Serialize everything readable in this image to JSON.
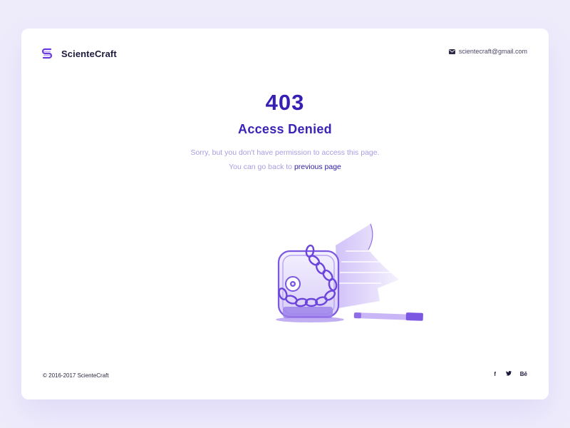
{
  "brand": {
    "name": "ScienteCraft",
    "logo_icon": "s-monogram-icon",
    "accent_color": "#6a3ce0"
  },
  "contact": {
    "icon": "mail-icon",
    "email": "scientecraft@gmail.com"
  },
  "error": {
    "code": "403",
    "title": "Access Denied",
    "message_line1": "Sorry, but you don't have permission to access this page.",
    "message_line2_prefix": "You can go back to ",
    "link_text": "previous page"
  },
  "footer": {
    "copyright": "© 2016-2017 ScienteCraft",
    "social": [
      {
        "icon": "facebook-icon",
        "label": "f"
      },
      {
        "icon": "twitter-icon",
        "label": "🐦"
      },
      {
        "icon": "behance-icon",
        "label": "Bē"
      }
    ]
  },
  "colors": {
    "primary": "#3620b4",
    "muted_text": "#a89ee0",
    "illustration": "#8f6ce8",
    "background": "#eeecfb"
  }
}
